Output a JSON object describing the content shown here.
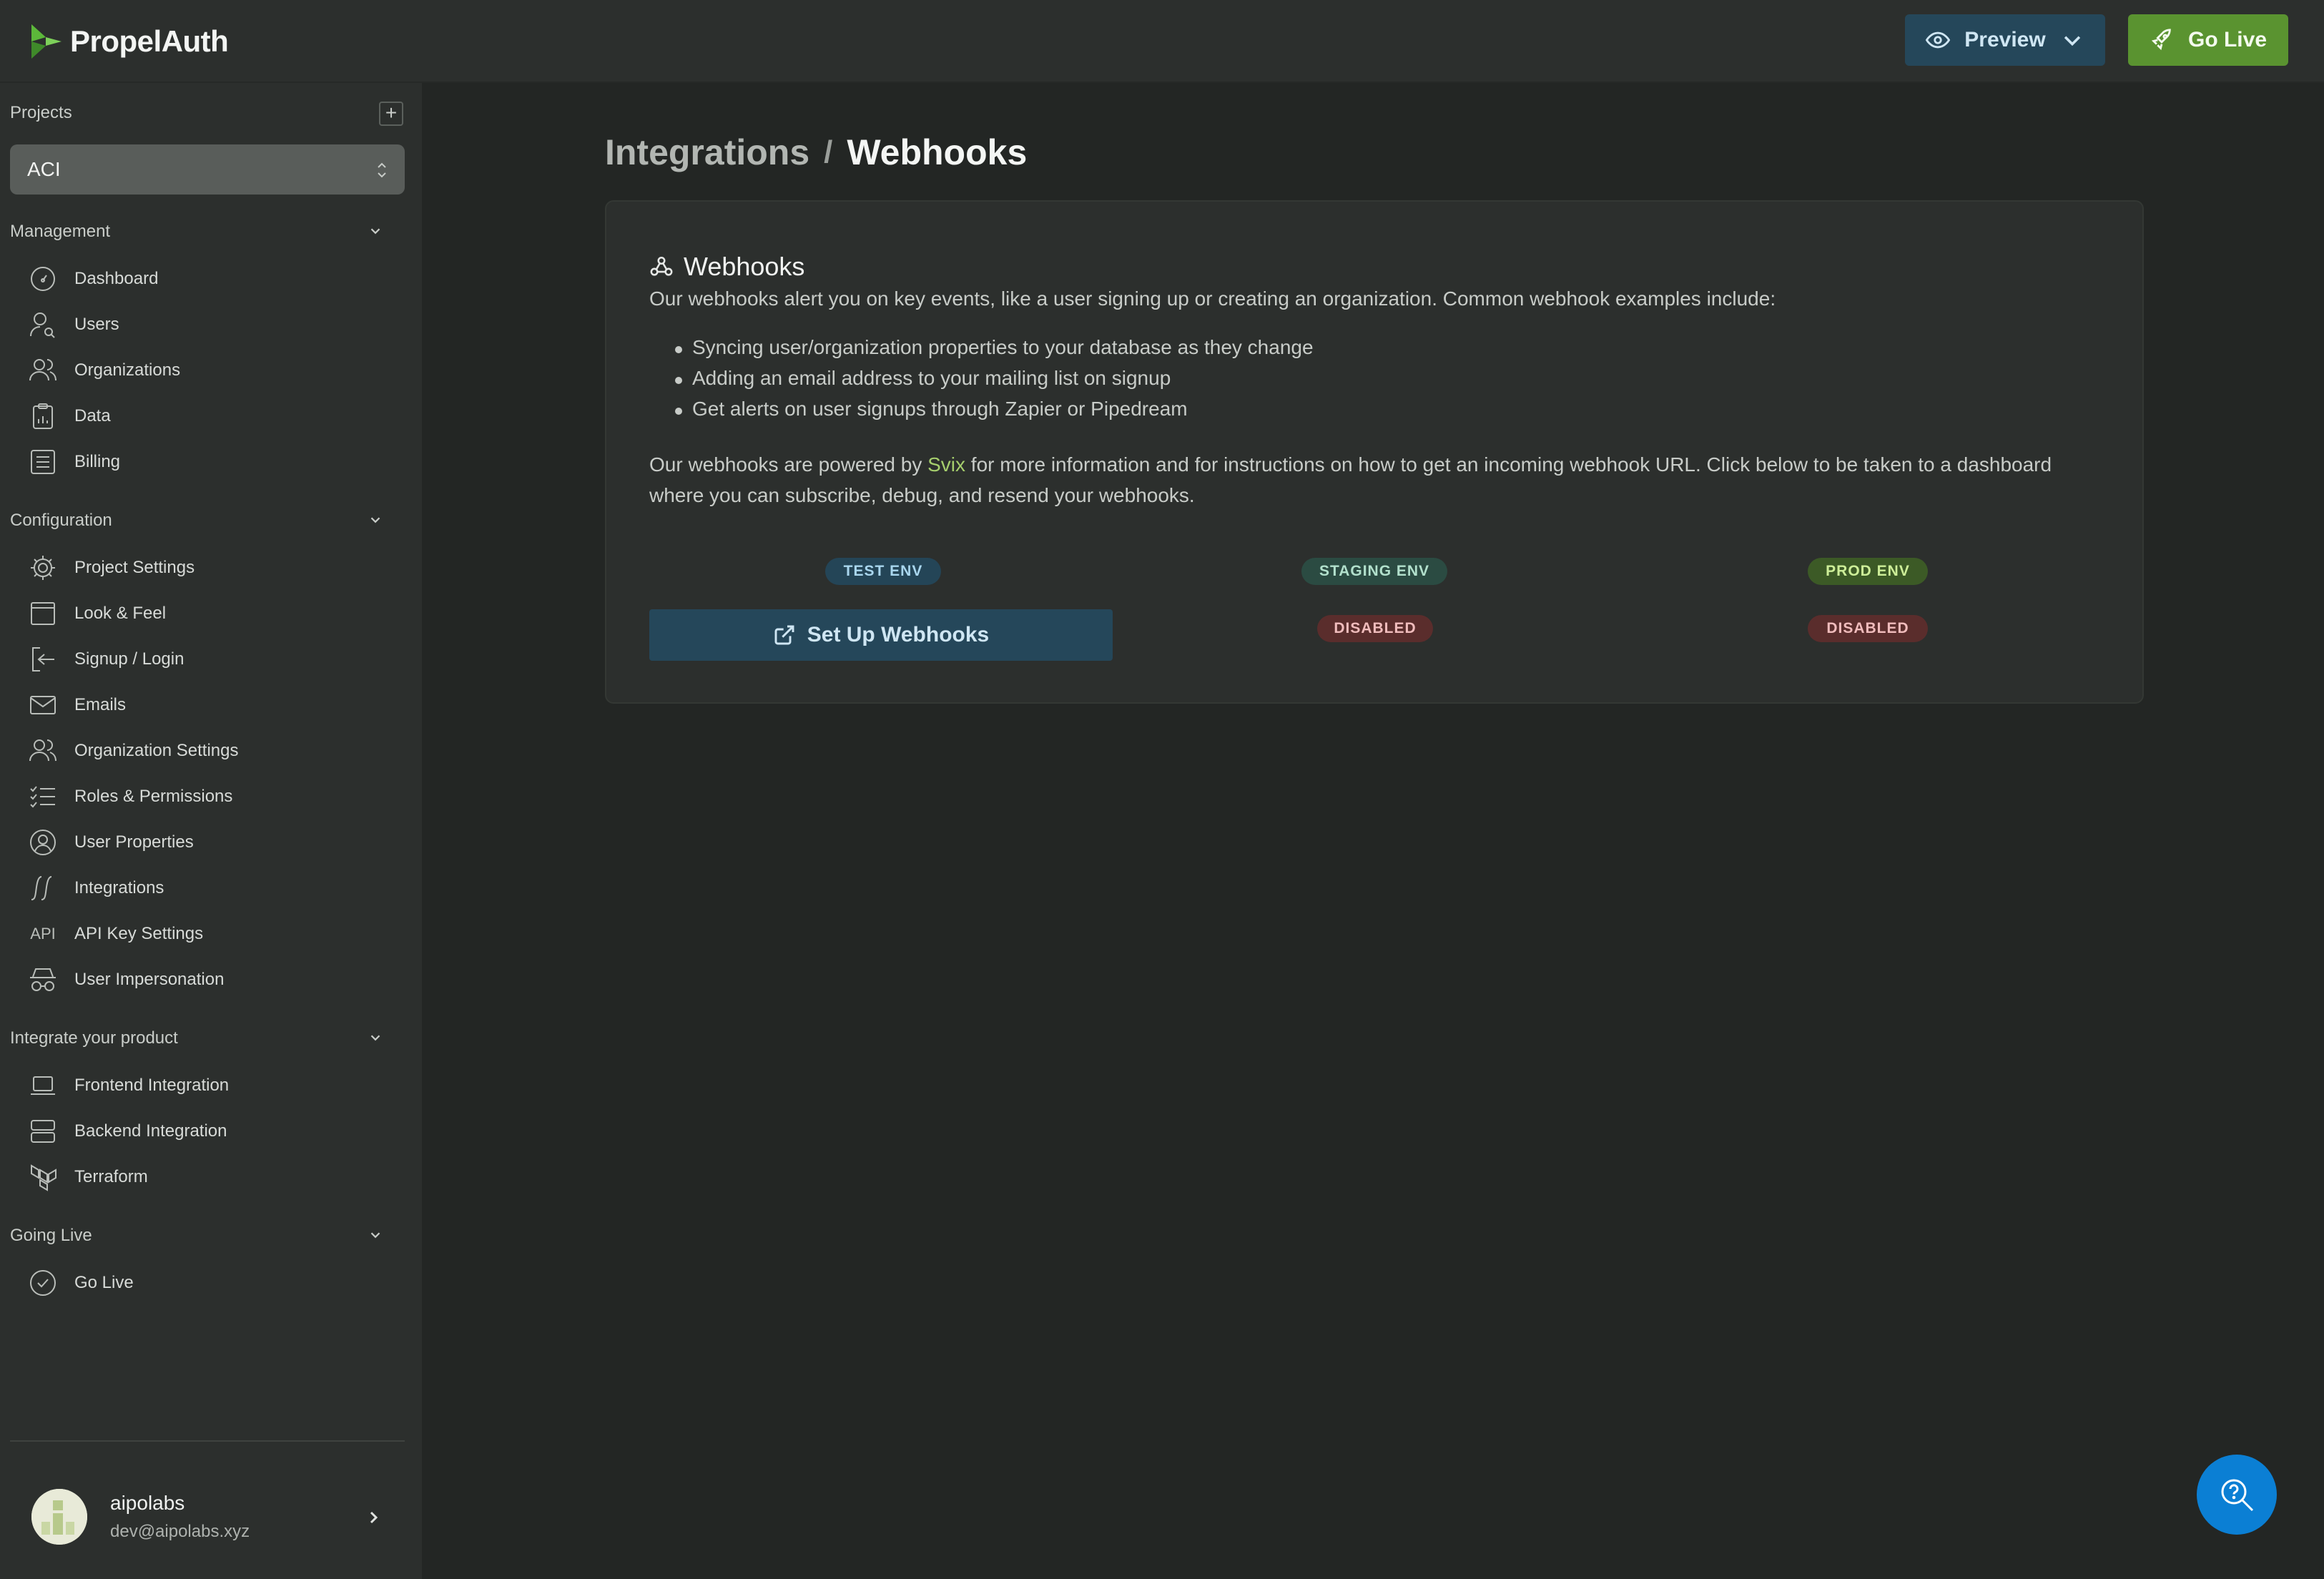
{
  "brand": {
    "name": "PropelAuth"
  },
  "header": {
    "preview_label": "Preview",
    "golive_label": "Go Live"
  },
  "sidebar": {
    "projects_label": "Projects",
    "add_symbol": "+",
    "selected_project": "ACI",
    "sections": {
      "management": "Management",
      "configuration": "Configuration",
      "integrate": "Integrate your product",
      "going_live": "Going Live"
    },
    "items": {
      "dashboard": "Dashboard",
      "users": "Users",
      "organizations": "Organizations",
      "data": "Data",
      "billing": "Billing",
      "project_settings": "Project Settings",
      "look_feel": "Look & Feel",
      "signup_login": "Signup / Login",
      "emails": "Emails",
      "organization_settings": "Organization Settings",
      "roles_permissions": "Roles & Permissions",
      "user_properties": "User Properties",
      "integrations": "Integrations",
      "api_key_settings": "API Key Settings",
      "api_icon_text": "API",
      "user_impersonation": "User Impersonation",
      "frontend_integration": "Frontend Integration",
      "backend_integration": "Backend Integration",
      "terraform": "Terraform",
      "go_live": "Go Live"
    },
    "user": {
      "name": "aipolabs",
      "email": "dev@aipolabs.xyz"
    }
  },
  "main": {
    "breadcrumb": {
      "parent": "Integrations",
      "separator": "/",
      "current": "Webhooks"
    },
    "card": {
      "title": "Webhooks",
      "description": "Our webhooks alert you on key events, like a user signing up or creating an organization. Common webhook examples include:",
      "examples": [
        "Syncing user/organization properties to your database as they change",
        "Adding an email address to your mailing list on signup",
        "Get alerts on user signups through Zapier or Pipedream"
      ],
      "para_before": "Our webhooks are powered by ",
      "svix_link": "Svix",
      "para_after": " for more information and for instructions on how to get an incoming webhook URL. Click below to be taken to a dashboard where you can subscribe, debug, and resend your webhooks.",
      "envs": {
        "test": "TEST ENV",
        "staging": "STAGING ENV",
        "prod": "PROD ENV"
      },
      "setup_button": "Set Up Webhooks",
      "staging_status": "DISABLED",
      "prod_status": "DISABLED"
    }
  },
  "colors": {
    "accent_green": "#5a9330",
    "accent_blue": "#25475a",
    "fab_blue": "#0b7fd4"
  }
}
